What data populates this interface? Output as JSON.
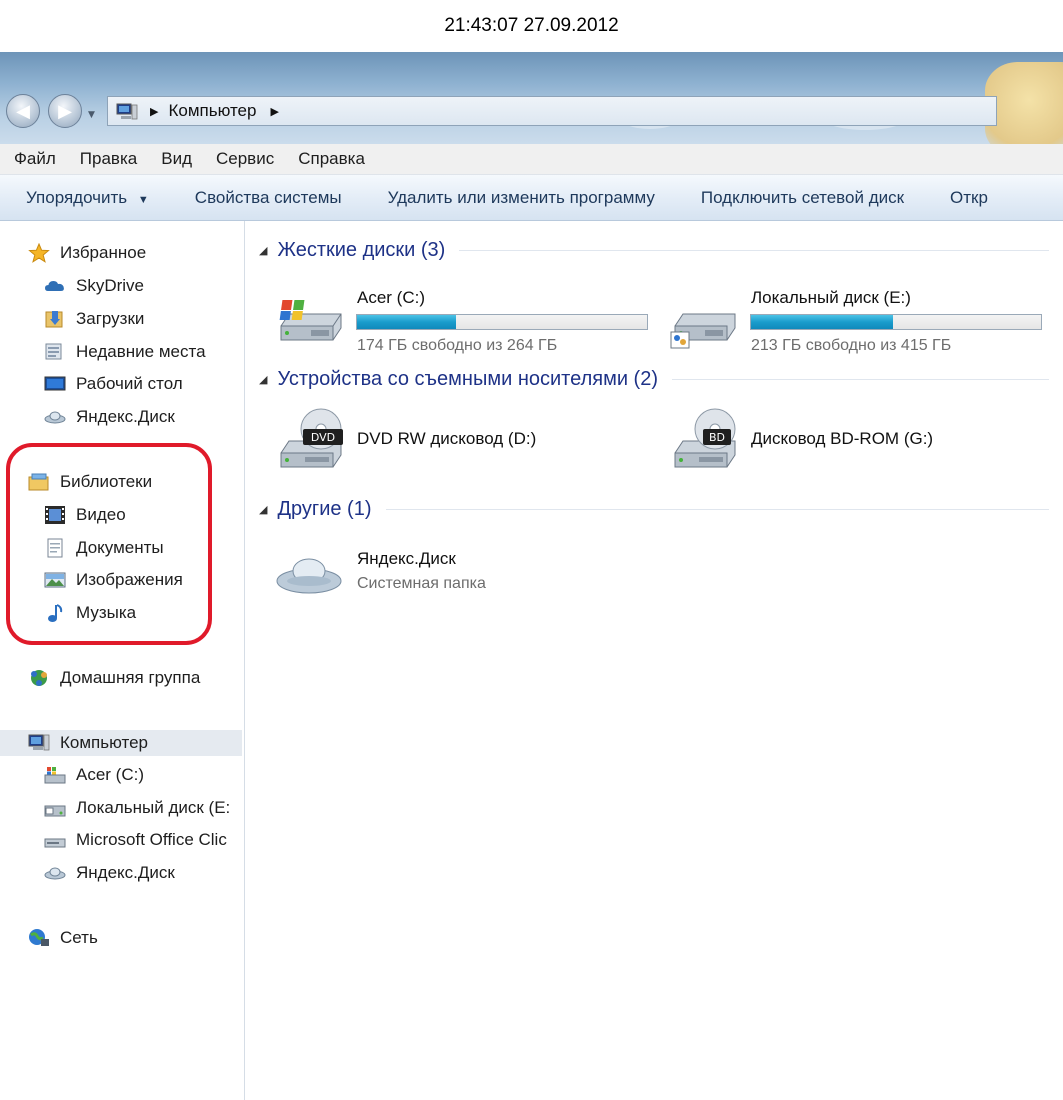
{
  "timestamp": "21:43:07 27.09.2012",
  "address": {
    "crumb": "Компьютер"
  },
  "menu": [
    "Файл",
    "Правка",
    "Вид",
    "Сервис",
    "Справка"
  ],
  "toolbar": {
    "organize": "Упорядочить",
    "system_props": "Свойства системы",
    "uninstall": "Удалить или изменить программу",
    "map_drive": "Подключить сетевой диск",
    "open_cp": "Откр"
  },
  "sidebar": {
    "favorites": "Избранное",
    "skydrive": "SkyDrive",
    "downloads": "Загрузки",
    "recent": "Недавние места",
    "desktop": "Рабочий стол",
    "yadisk_fav": "Яндекс.Диск",
    "libraries": "Библиотеки",
    "video": "Видео",
    "documents": "Документы",
    "images": "Изображения",
    "music": "Музыка",
    "homegroup": "Домашняя группа",
    "computer": "Компьютер",
    "acer": "Acer (C:)",
    "local_e": "Локальный диск (E:",
    "office": "Microsoft Office Clic",
    "yadisk_pc": "Яндекс.Диск",
    "network": "Сеть"
  },
  "groups": {
    "hdd": "Жесткие диски (3)",
    "removable": "Устройства со съемными носителями (2)",
    "other": "Другие (1)"
  },
  "drives": {
    "c": {
      "name": "Acer (C:)",
      "free": "174 ГБ свободно из 264 ГБ",
      "used_fraction": 0.34
    },
    "e": {
      "name": "Локальный диск (E:)",
      "free": "213 ГБ свободно из 415 ГБ",
      "used_fraction": 0.49
    }
  },
  "removable": {
    "dvd": {
      "name": "DVD RW дисковод (D:)",
      "badge": "DVD"
    },
    "bd": {
      "name": "Дисковод BD-ROM (G:)",
      "badge": "BD"
    }
  },
  "other": {
    "yadisk": {
      "name": "Яндекс.Диск",
      "desc": "Системная папка"
    }
  },
  "colors": {
    "highlight_box": "#e01a2a",
    "group_header": "#1e3287",
    "bar_fill": "#1a9ccc"
  }
}
